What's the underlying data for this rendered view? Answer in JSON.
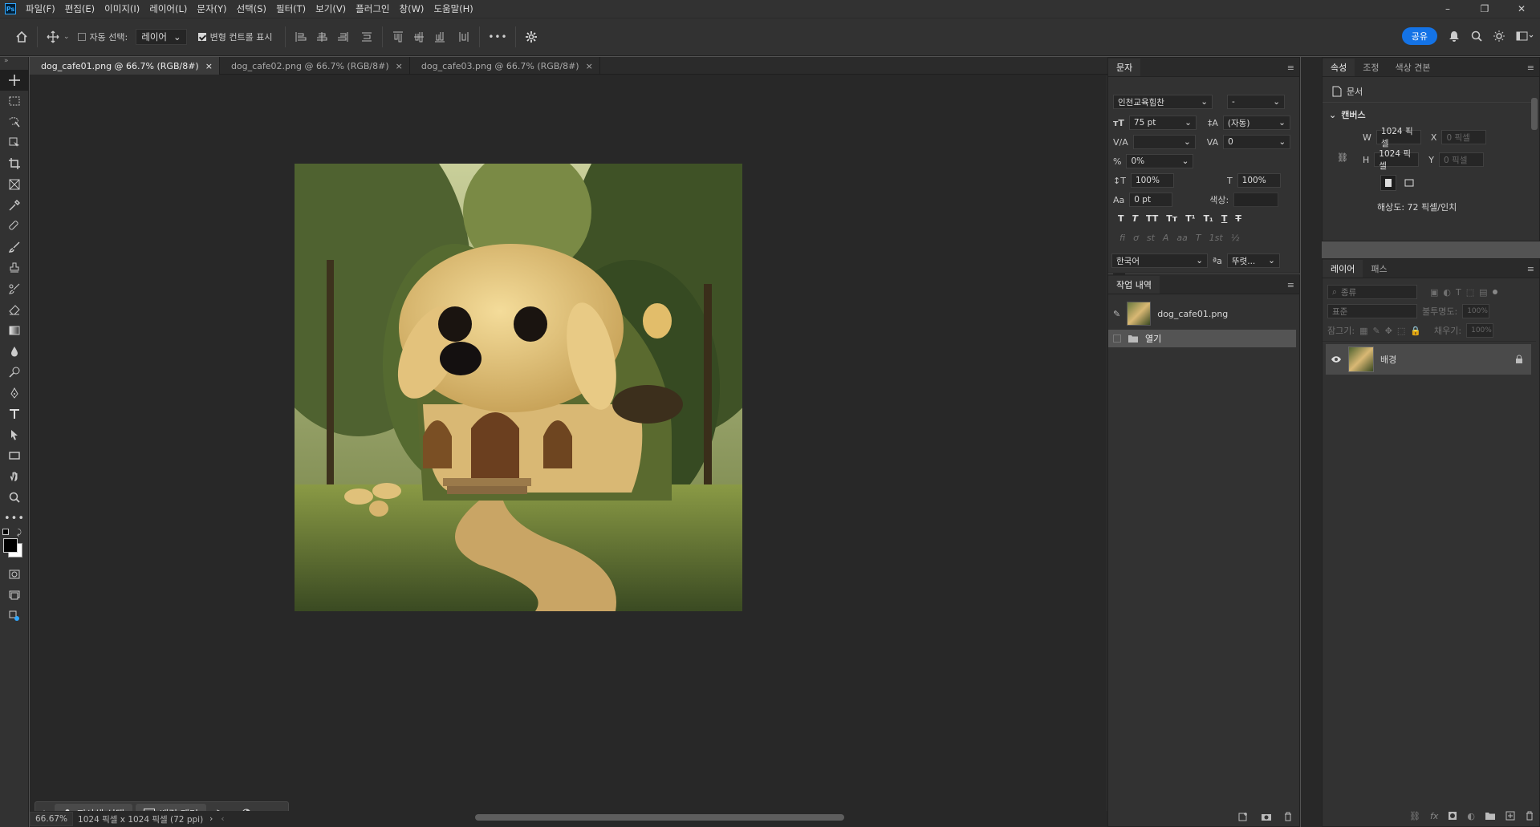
{
  "app": {
    "logo": "Ps"
  },
  "menu": [
    "파일(F)",
    "편집(E)",
    "이미지(I)",
    "레이어(L)",
    "문자(Y)",
    "선택(S)",
    "필터(T)",
    "보기(V)",
    "플러그인",
    "창(W)",
    "도움말(H)"
  ],
  "window_controls": {
    "minimize": "–",
    "restore": "❐",
    "close": "✕"
  },
  "options": {
    "auto_select_label": "자동 선택:",
    "auto_select_target": "레이어",
    "show_transform_label": "변형 컨트롤 표시",
    "more": "•••",
    "share_label": "공유"
  },
  "tabs": [
    {
      "label": "dog_cafe01.png @ 66.7% (RGB/8#)",
      "close": "×"
    },
    {
      "label": "dog_cafe02.png @ 66.7% (RGB/8#)",
      "close": "×"
    },
    {
      "label": "dog_cafe03.png @ 66.7% (RGB/8#)",
      "close": "×"
    }
  ],
  "contextual_bar": {
    "select_subject": "피사체 선택",
    "remove_bg": "배경 제거",
    "more": "•••"
  },
  "status": {
    "zoom": "66.67%",
    "info": "1024 픽셀 x 1024 픽셀 (72 ppi)",
    "arrow": "›",
    "left_arrow": "‹"
  },
  "character_panel": {
    "tab": "문자",
    "font_family": "인천교육힘찬",
    "font_style": "-",
    "font_size": "75 pt",
    "leading": "(자동)",
    "kerning": "",
    "tracking": "0",
    "tsume": "0%",
    "vertical_scale": "100%",
    "horizontal_scale": "100%",
    "baseline_shift": "0 pt",
    "color_label": "색상:",
    "style_buttons": [
      "T",
      "T",
      "TT",
      "Tт",
      "T¹",
      "T₁",
      "T",
      "T"
    ],
    "opentype_buttons": [
      "fi",
      "ơ",
      "st",
      "A",
      "aa",
      "T",
      "1st",
      "½"
    ],
    "language": "한국어",
    "aa_label": "ªa",
    "antialias": "뚜렷..."
  },
  "history_panel": {
    "tab": "작업 내역",
    "snapshot": "dog_cafe01.png",
    "steps": [
      "열기"
    ]
  },
  "properties_panel": {
    "tabs": [
      "속성",
      "조정",
      "색상 견본"
    ],
    "doc_label": "문서",
    "section": "캔버스",
    "w_label": "W",
    "w_value": "1024 픽셀",
    "h_label": "H",
    "h_value": "1024 픽셀",
    "x_label": "X",
    "x_value": "0 픽셀",
    "y_label": "Y",
    "y_value": "0 픽셀",
    "resolution": "해상도: 72 픽셀/인치"
  },
  "layers_panel": {
    "tabs": [
      "레이어",
      "패스"
    ],
    "filter_placeholder": "종류",
    "blend_mode": "표준",
    "opacity_label": "불투명도:",
    "opacity": "100%",
    "lock_label": "잠그기:",
    "fill_label": "채우기:",
    "fill": "100%",
    "layers": [
      {
        "name": "배경",
        "visible": true,
        "locked": true
      }
    ]
  },
  "colors": {
    "accent": "#1473e6",
    "panel": "#323232",
    "canvas_bg": "#282828"
  }
}
